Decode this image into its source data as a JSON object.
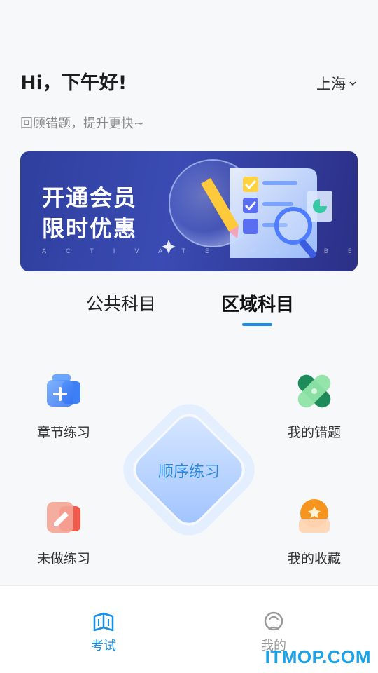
{
  "header": {
    "greeting": "Hi，下午好!",
    "subtitle": "回顾错题，提升更快~",
    "city": "上海"
  },
  "banner": {
    "title_line1": "开通会员",
    "title_line2": "限时优惠",
    "subtitle_en": "ACTIVATE MEMBERSHIP"
  },
  "tabs": [
    {
      "label": "公共科目",
      "active": false
    },
    {
      "label": "区域科目",
      "active": true
    }
  ],
  "features": {
    "chapter": "章节练习",
    "wrong": "我的错题",
    "undone": "未做练习",
    "favorites": "我的收藏",
    "sequential": "顺序练习"
  },
  "bottom_nav": [
    {
      "label": "考试",
      "icon": "book-icon",
      "active": true
    },
    {
      "label": "我的",
      "icon": "user-icon",
      "active": false
    }
  ],
  "watermark": "ITMOP.COM",
  "colors": {
    "accent": "#1a8fe6",
    "banner_bg": "#2f3f9e"
  }
}
